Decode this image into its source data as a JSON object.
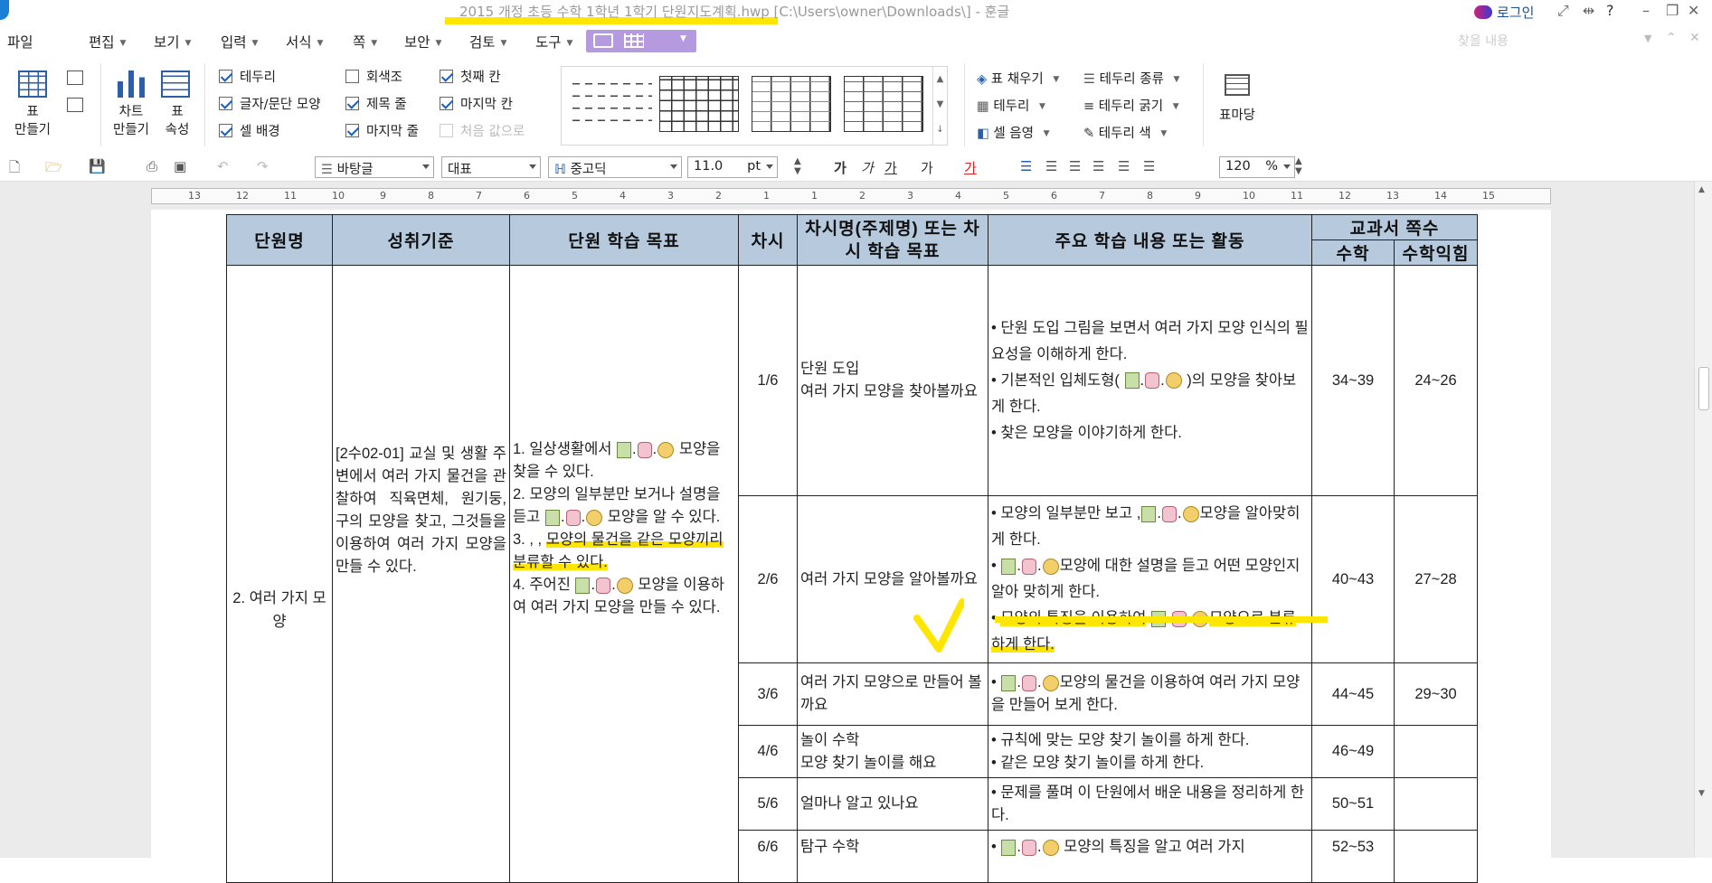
{
  "titlebar": {
    "title": "2015 개정 초등 수학 1학년 1학기 단원지도계획.hwp [C:\\Users\\owner\\Downloads\\] - 훈글",
    "login": "로그인",
    "help": "?"
  },
  "menu": {
    "items": [
      "파일",
      "편집",
      "보기",
      "입력",
      "서식",
      "쪽",
      "보안",
      "검토",
      "도구"
    ],
    "search_placeholder": "찾을 내용"
  },
  "ribbon": {
    "make_table": "표\n만들기",
    "make_chart": "차트\n만들기",
    "table_props": "표\n속성",
    "checks": [
      {
        "label": "테두리",
        "checked": true
      },
      {
        "label": "글자/문단 모양",
        "checked": true
      },
      {
        "label": "셀 배경",
        "checked": true
      },
      {
        "label": "회색조",
        "checked": false
      },
      {
        "label": "제목 줄",
        "checked": true
      },
      {
        "label": "마지막 줄",
        "checked": true
      },
      {
        "label": "첫째 칸",
        "checked": true
      },
      {
        "label": "마지막 칸",
        "checked": true
      },
      {
        "label": "처음 값으로",
        "checked": false
      }
    ],
    "right_tools": [
      "표 채우기",
      "테두리",
      "셀 음영",
      "테두리 종류",
      "테두리 굵기",
      "테두리 색"
    ],
    "table_anchor": "표마당"
  },
  "toolbar": {
    "style": "바탕글",
    "lang": "대표",
    "font": "중고딕",
    "size": "11.0",
    "unit": "pt",
    "zoom": "120",
    "zoom_unit": "%",
    "fmt": [
      "가",
      "가",
      "가",
      "가",
      "가"
    ]
  },
  "ruler": {
    "numbers": [
      "13",
      "12",
      "11",
      "10",
      "9",
      "8",
      "7",
      "6",
      "5",
      "4",
      "3",
      "2",
      "1",
      "1",
      "2",
      "3",
      "4",
      "5",
      "6",
      "7",
      "8",
      "9",
      "10",
      "11",
      "12",
      "13",
      "14",
      "15"
    ]
  },
  "table": {
    "headers": [
      "단원명",
      "성취기준",
      "단원 학습 목표",
      "차시",
      "차시명(주제명) 또는 차시 학습 목표",
      "주요 학습 내용 또는 활동",
      "교과서 쪽수",
      "수학",
      "수학익힘"
    ],
    "unit": "2. 여러 가지 모양",
    "standard": "[2수02-01] 교실 및 생활 주변에서 여러 가지 물건을 관찰하여 직육면체, 원기둥, 구의 모양을 찾고, 그것들을 이용하여 여러 가지 모양을 만들 수 있다.",
    "goals": [
      "1. 일상생활에서",
      "모양을 찾을 수 있다.",
      "2. 모양의 일부분만 보거나 설명을 듣고",
      "모양을 알 수 있다.",
      "3. , , ",
      "모양의 물건을 같은 모양끼리 분류할 수 있다.",
      "4. 주어진",
      "모양을 이용하여 여러 가지 모양을 만들 수 있다."
    ],
    "rows": [
      {
        "period": "1/6",
        "title": "단원 도입\n여러 가지 모양을 찾아볼까요",
        "acts": [
          "단원 도입 그림을 보면서 여러 가지 모양 인식의 필요성을 이해하게 한다.",
          "기본적인 입체도형(",
          "의 모양을 찾아보게 한다.",
          "찾은 모양을 이야기하게 한다."
        ],
        "math": "34~39",
        "work": "24~26"
      },
      {
        "period": "2/6",
        "title": "여러 가지 모양을 알아볼까요",
        "acts": [
          "모양의 일부분만 보고 ,",
          "모양을 알아맞히게 한다.",
          "모양에 대한 설명을 듣고 어떤 모양인지 알아 맞히게 한다.",
          "모양의 특징을 이용하여",
          "모양으로 분류하게 한다."
        ],
        "math": "40~43",
        "work": "27~28"
      },
      {
        "period": "3/6",
        "title": "여러 가지 모양으로 만들어 볼까요",
        "acts": [
          "모양의 물건을 이용하여 여러 가지 모양을 만들어 보게 한다."
        ],
        "math": "44~45",
        "work": "29~30"
      },
      {
        "period": "4/6",
        "title": "놀이 수학\n모양 찾기 놀이를 해요",
        "acts": [
          "규칙에 맞는 모양 찾기 놀이를 하게 한다.",
          "같은 모양 찾기 놀이를 하게 한다."
        ],
        "math": "46~49",
        "work": ""
      },
      {
        "period": "5/6",
        "title": "얼마나 알고 있나요",
        "acts": [
          "문제를 풀며 이 단원에서 배운 내용을 정리하게 한다."
        ],
        "math": "50~51",
        "work": ""
      },
      {
        "period": "6/6",
        "title": "탐구 수학",
        "acts": [
          "모양의 특징을 알고 여러 가지"
        ],
        "math": "52~53",
        "work": ""
      }
    ]
  }
}
